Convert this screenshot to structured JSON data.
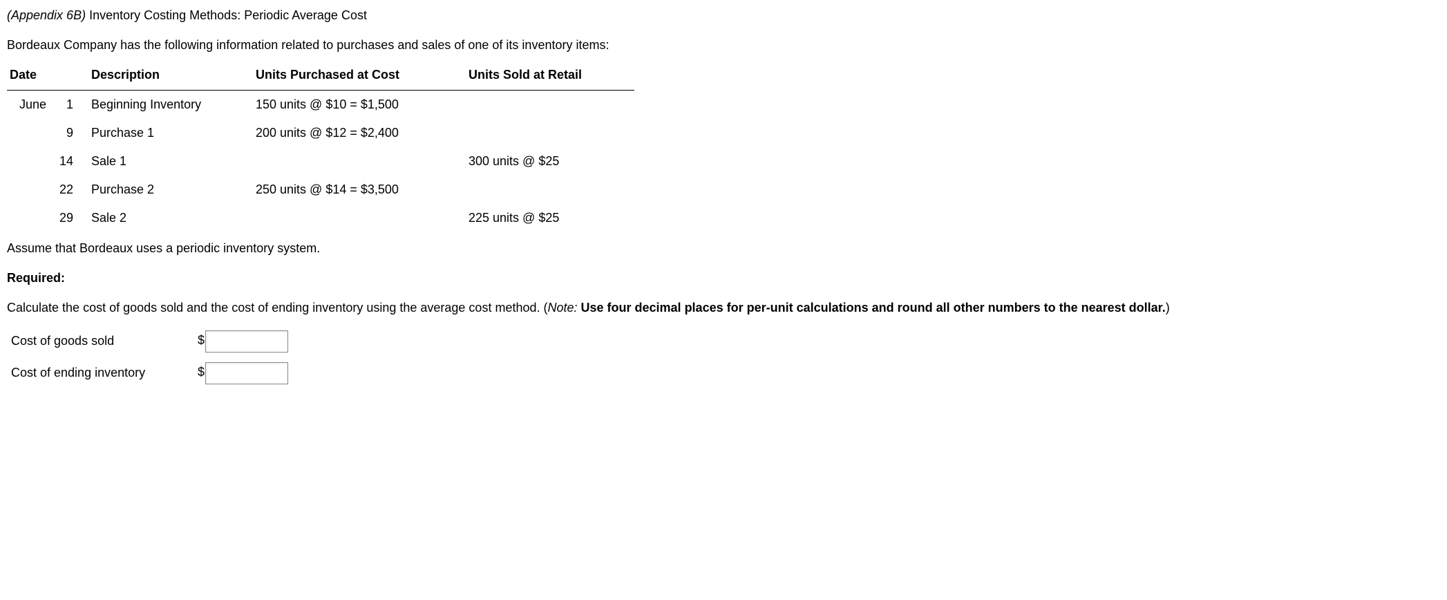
{
  "title": {
    "prefix": "(Appendix 6B)",
    "rest": " Inventory Costing Methods: Periodic Average Cost"
  },
  "intro": "Bordeaux Company has the following information related to purchases and sales of one of its inventory items:",
  "table": {
    "headers": {
      "date": "Date",
      "description": "Description",
      "purchased": "Units Purchased at Cost",
      "sold": "Units Sold at Retail"
    },
    "rows": [
      {
        "month": "June",
        "day": "1",
        "description": "Beginning Inventory",
        "purchased": "150 units @ $10 = $1,500",
        "sold": ""
      },
      {
        "month": "",
        "day": "9",
        "description": "Purchase 1",
        "purchased": "200 units @ $12 = $2,400",
        "sold": ""
      },
      {
        "month": "",
        "day": "14",
        "description": "Sale 1",
        "purchased": "",
        "sold": "300 units @ $25"
      },
      {
        "month": "",
        "day": "22",
        "description": "Purchase 2",
        "purchased": "250 units @ $14 = $3,500",
        "sold": ""
      },
      {
        "month": "",
        "day": "29",
        "description": "Sale 2",
        "purchased": "",
        "sold": "225 units @ $25"
      }
    ]
  },
  "assume": "Assume that Bordeaux uses a periodic inventory system.",
  "required_label": "Required:",
  "instructions": {
    "lead": "Calculate the cost of goods sold and the cost of ending inventory using the average cost method. (",
    "note_label": "Note:",
    "note_bold": " Use four decimal places for per-unit calculations and round all other numbers to the nearest dollar.",
    "close": ")"
  },
  "answers": {
    "cogs_label": "Cost of goods sold",
    "ending_label": "Cost of ending inventory",
    "currency": "$",
    "cogs_value": "",
    "ending_value": ""
  },
  "chart_data": {
    "type": "table",
    "title": "Inventory purchases and sales",
    "columns": [
      "Date",
      "Description",
      "Units Purchased at Cost",
      "Units Sold at Retail"
    ],
    "rows": [
      [
        "June 1",
        "Beginning Inventory",
        "150 units @ $10 = $1,500",
        ""
      ],
      [
        "9",
        "Purchase 1",
        "200 units @ $12 = $2,400",
        ""
      ],
      [
        "14",
        "Sale 1",
        "",
        "300 units @ $25"
      ],
      [
        "22",
        "Purchase 2",
        "250 units @ $14 = $3,500",
        ""
      ],
      [
        "29",
        "Sale 2",
        "",
        "225 units @ $25"
      ]
    ]
  }
}
